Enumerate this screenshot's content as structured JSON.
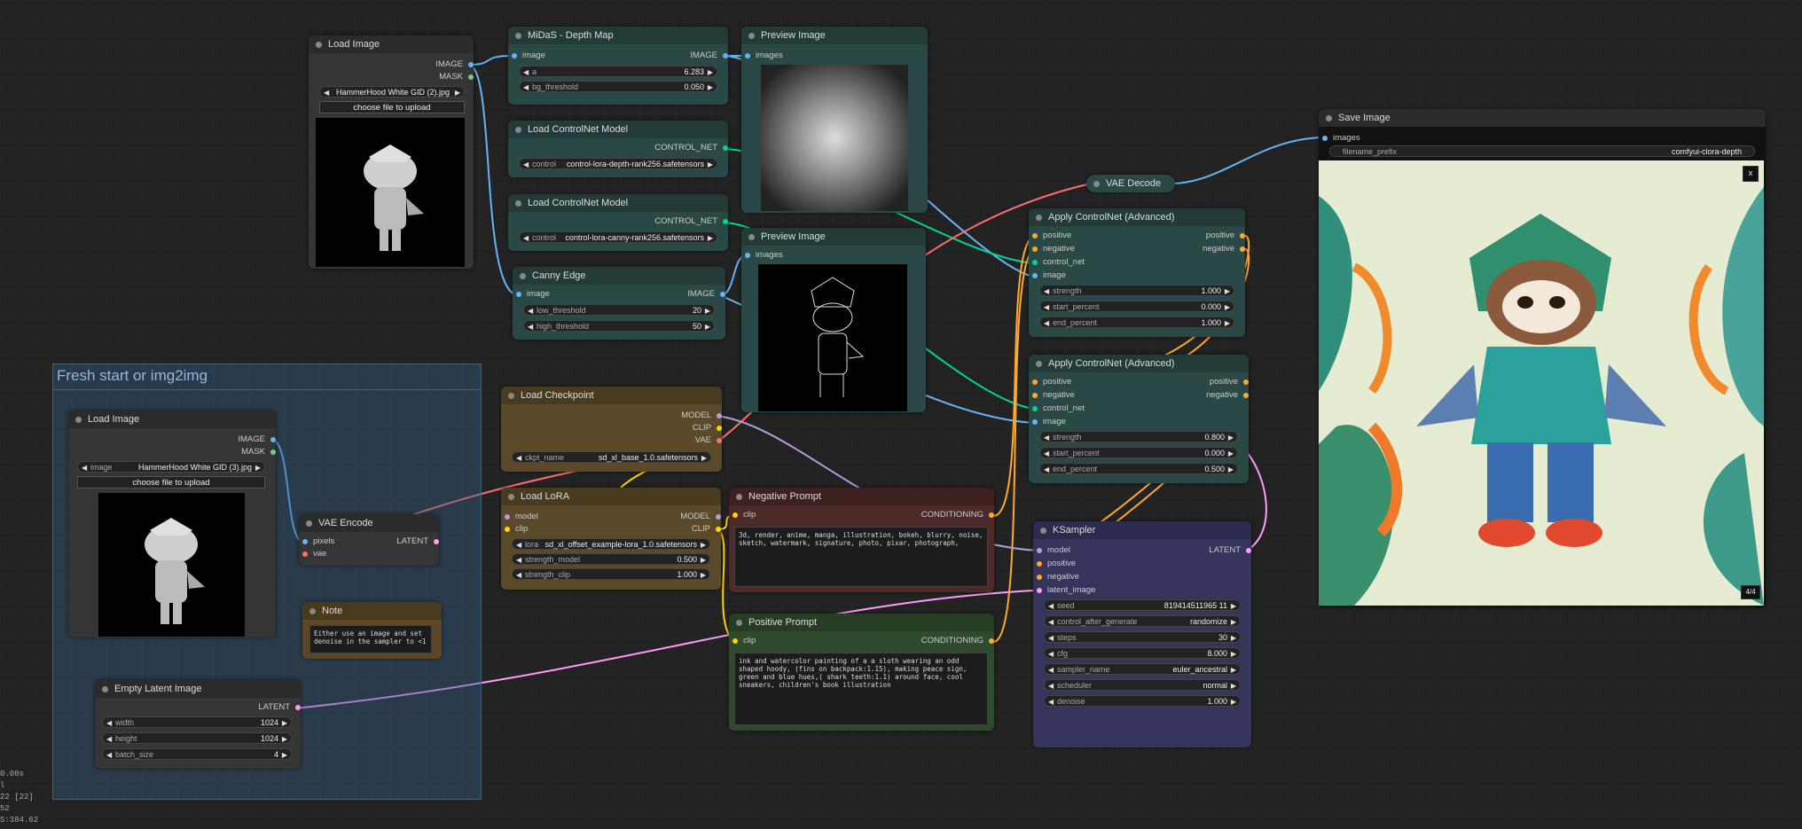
{
  "group": {
    "title": "Fresh start or img2img"
  },
  "load_image_1": {
    "title": "Load Image",
    "out_image": "IMAGE",
    "out_mask": "MASK",
    "filename": "HammerHood White GID (2).jpg",
    "upload": "choose file to upload"
  },
  "load_image_2": {
    "title": "Load Image",
    "out_image": "IMAGE",
    "out_mask": "MASK",
    "widget_label": "image",
    "filename": "HammerHood White GID (3).jpg",
    "upload": "choose file to upload"
  },
  "midas": {
    "title": "MiDaS - Depth Map",
    "in_image": "image",
    "out_image": "IMAGE",
    "a_label": "a",
    "a_value": "6.283",
    "bg_label": "bg_threshold",
    "bg_value": "0.050"
  },
  "cn_model_1": {
    "title": "Load ControlNet Model",
    "out": "CONTROL_NET",
    "label": "control",
    "value": "control-lora-depth-rank256.safetensors"
  },
  "cn_model_2": {
    "title": "Load ControlNet Model",
    "out": "CONTROL_NET",
    "label": "control",
    "value": "control-lora-canny-rank256.safetensors"
  },
  "canny": {
    "title": "Canny Edge",
    "in_image": "image",
    "out_image": "IMAGE",
    "low_label": "low_threshold",
    "low_value": "20",
    "high_label": "high_threshold",
    "high_value": "50"
  },
  "preview_1": {
    "title": "Preview Image",
    "in_images": "images"
  },
  "preview_2": {
    "title": "Preview Image",
    "in_images": "images"
  },
  "checkpoint": {
    "title": "Load Checkpoint",
    "out_model": "MODEL",
    "out_clip": "CLIP",
    "out_vae": "VAE",
    "label": "ckpt_name",
    "value": "sd_xl_base_1.0.safetensors"
  },
  "lora": {
    "title": "Load LoRA",
    "in_model": "model",
    "in_clip": "clip",
    "out_model": "MODEL",
    "out_clip": "CLIP",
    "lora_label": "lora",
    "lora_value": "sd_xl_offset_example-lora_1.0.safetensors",
    "sm_label": "strength_model",
    "sm_value": "0.500",
    "sc_label": "strength_clip",
    "sc_value": "1.000"
  },
  "vae_encode": {
    "title": "VAE Encode",
    "in_pixels": "pixels",
    "in_vae": "vae",
    "out": "LATENT"
  },
  "note": {
    "title": "Note",
    "text": "Either use an image and set denoise in the sampler to <1"
  },
  "empty_latent": {
    "title": "Empty Latent Image",
    "out": "LATENT",
    "w_label": "width",
    "w_value": "1024",
    "h_label": "height",
    "h_value": "1024",
    "b_label": "batch_size",
    "b_value": "4"
  },
  "neg_prompt": {
    "title": "Negative Prompt",
    "in_clip": "clip",
    "out": "CONDITIONING",
    "text": "3d, render, anime, manga, illustration, bokeh, blurry, noise, sketch, watermark, signature, photo, pixar, photograph,"
  },
  "pos_prompt": {
    "title": "Positive Prompt",
    "in_clip": "clip",
    "out": "CONDITIONING",
    "text": "ink and watercolor painting of a a sloth wearing an odd shaped hoody, (fins on backpack:1.15), making peace sign, green and blue hues,( shark teeth:1.1) around face, cool sneakers, children's book illustration"
  },
  "vae_decode": {
    "title": "VAE Decode"
  },
  "apply_cn_1": {
    "title": "Apply ControlNet (Advanced)",
    "in_pos": "positive",
    "in_neg": "negative",
    "in_cn": "control_net",
    "in_img": "image",
    "out_pos": "positive",
    "out_neg": "negative",
    "s_label": "strength",
    "s_value": "1.000",
    "sp_label": "start_percent",
    "sp_value": "0.000",
    "ep_label": "end_percent",
    "ep_value": "1.000"
  },
  "apply_cn_2": {
    "title": "Apply ControlNet (Advanced)",
    "in_pos": "positive",
    "in_neg": "negative",
    "in_cn": "control_net",
    "in_img": "image",
    "out_pos": "positive",
    "out_neg": "negative",
    "s_label": "strength",
    "s_value": "0.800",
    "sp_label": "start_percent",
    "sp_value": "0.000",
    "ep_label": "end_percent",
    "ep_value": "0.500"
  },
  "ksampler": {
    "title": "KSampler",
    "in_model": "model",
    "in_pos": "positive",
    "in_neg": "negative",
    "in_latent": "latent_image",
    "out": "LATENT",
    "widgets": [
      {
        "label": "seed",
        "value": "819414511965 11"
      },
      {
        "label": "control_after_generate",
        "value": "randomize"
      },
      {
        "label": "steps",
        "value": "30"
      },
      {
        "label": "cfg",
        "value": "8.000"
      },
      {
        "label": "sampler_name",
        "value": "euler_ancestral"
      },
      {
        "label": "scheduler",
        "value": "normal"
      },
      {
        "label": "denoise",
        "value": "1.000"
      }
    ]
  },
  "save_image": {
    "title": "Save Image",
    "in_images": "images",
    "prefix_label": "filename_prefix",
    "prefix_value": "comfyui-clora-depth",
    "close": "x",
    "counter": "4/4"
  },
  "stats": {
    "l1": "0.00s",
    "l2": "l",
    "l3": "22 [22]",
    "l4": "52",
    "l5": "S:384.62"
  },
  "colors": {
    "image": "#64b5f6",
    "mask": "#81c784",
    "clip": "#ffd500",
    "model": "#b39ddb",
    "vae": "#ff6e6e",
    "latent": "#ff9cf9",
    "conditioning": "#ffa931",
    "control_net": "#00d78d"
  }
}
